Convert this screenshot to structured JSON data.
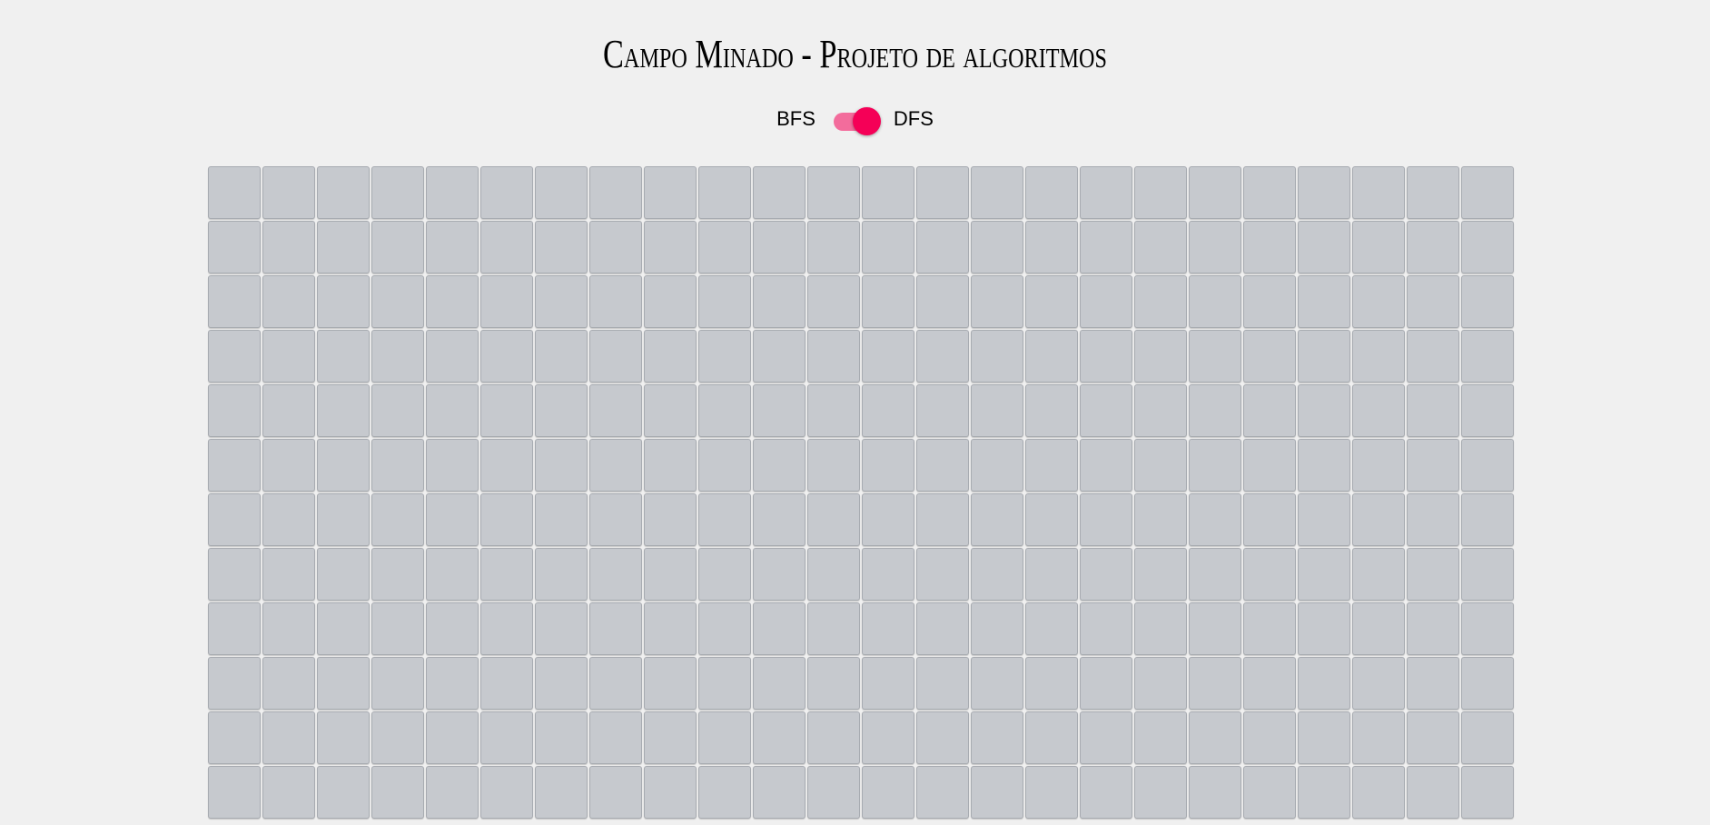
{
  "header": {
    "title": "Campo Minado - Projeto de algoritmos"
  },
  "algorithm_toggle": {
    "left_label": "BFS",
    "right_label": "DFS",
    "selected": "DFS",
    "accent_color": "#f50057"
  },
  "board": {
    "columns": 24,
    "visible_rows": 12,
    "cell_state": "hidden",
    "cell_color": "#c6c9ce"
  }
}
